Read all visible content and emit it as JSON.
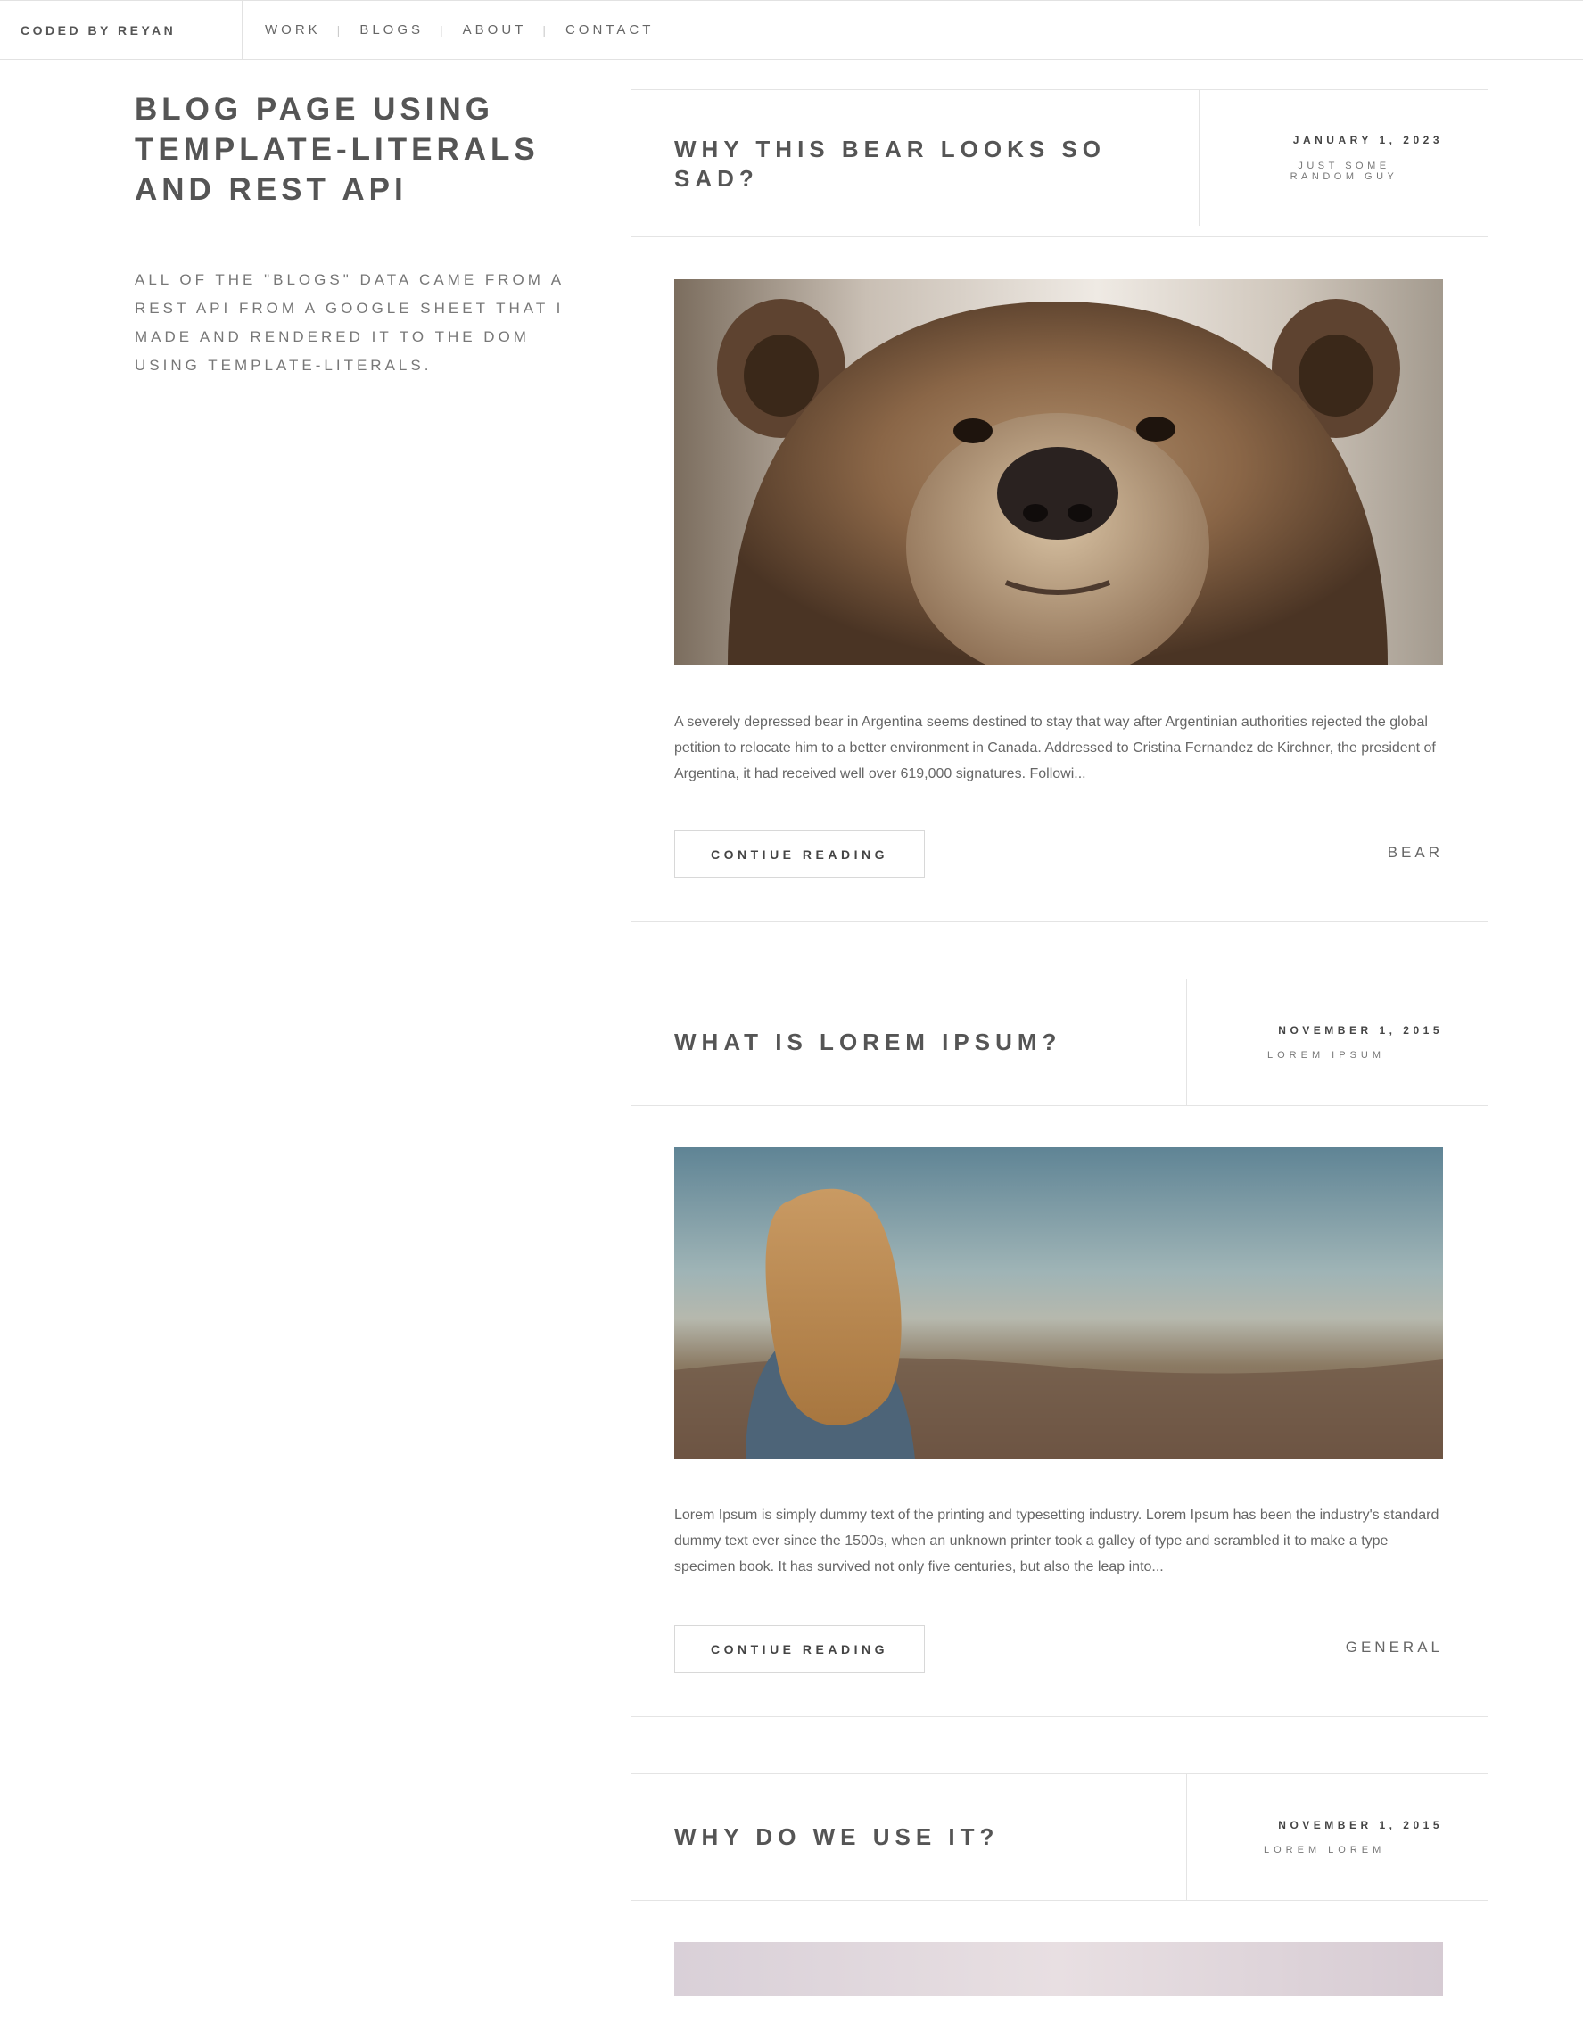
{
  "nav": {
    "brand": "CODED BY REYAN",
    "links": [
      "WORK",
      "BLOGS",
      "ABOUT",
      "CONTACT"
    ],
    "separator": "|"
  },
  "intro": {
    "title": "BLOG PAGE USING TEMPLATE-LITERALS AND REST API",
    "description": "ALL OF THE \"BLOGS\" DATA CAME FROM A REST API FROM A GOOGLE SHEET THAT I MADE AND RENDERED IT TO THE DOM USING TEMPLATE-LITERALS."
  },
  "posts": [
    {
      "title": "WHY THIS BEAR LOOKS SO SAD?",
      "date": "JANUARY 1, 2023",
      "author": "JUST SOME RANDOM GUY",
      "image": "bear-photo",
      "excerpt": "A severely depressed bear in Argentina seems destined to stay that way after Argentinian authorities rejected the global petition to relocate him to a better environment in Canada. Addressed to Cristina Fernandez de Kirchner, the president of Argentina, it had received well over 619,000 signatures. Followi...",
      "button": "CONTIUE READING",
      "tag": "BEAR"
    },
    {
      "title": "WHAT IS LOREM IPSUM?",
      "date": "NOVEMBER 1, 2015",
      "author": "LOREM IPSUM",
      "image": "woman-landscape-photo",
      "excerpt": "Lorem Ipsum is simply dummy text of the printing and typesetting industry. Lorem Ipsum has been the industry's standard dummy text ever since the 1500s, when an unknown printer took a galley of type and scrambled it to make a type specimen book. It has survived not only five centuries, but also the leap into...",
      "button": "CONTIUE READING",
      "tag": "GENERAL"
    },
    {
      "title": "WHY DO WE USE IT?",
      "date": "NOVEMBER 1, 2015",
      "author": "LOREM LOREM",
      "image": "pastel-photo"
    }
  ]
}
